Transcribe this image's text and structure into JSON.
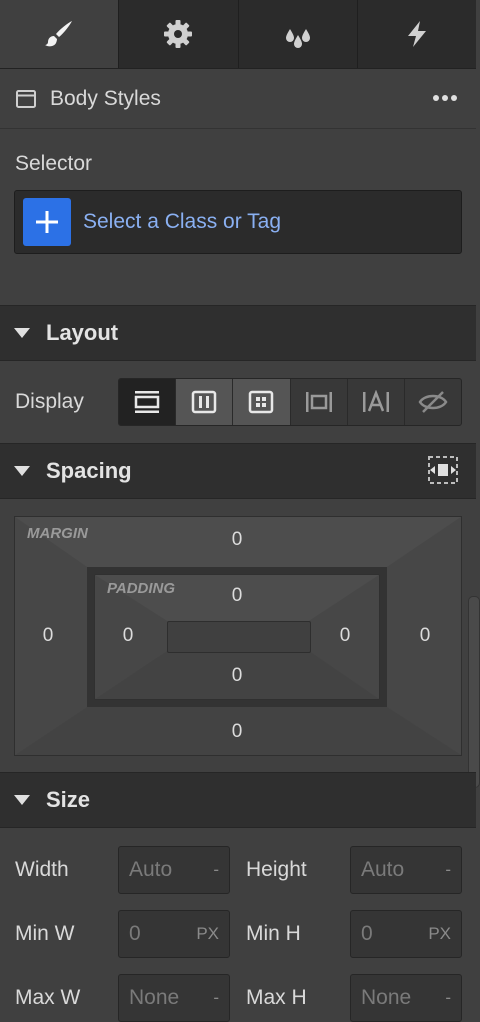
{
  "tabs": [
    {
      "icon": "paintbrush-icon",
      "active": true
    },
    {
      "icon": "gear-icon",
      "active": false
    },
    {
      "icon": "droplets-icon",
      "active": false
    },
    {
      "icon": "lightning-icon",
      "active": false
    }
  ],
  "styles_header": {
    "title": "Body Styles",
    "icon": "window-icon",
    "more_icon": "more-dots-icon"
  },
  "selector": {
    "label": "Selector",
    "placeholder": "Select a Class or Tag",
    "accent": "#2c71e6"
  },
  "layout": {
    "title": "Layout",
    "display_label": "Display",
    "display_options": [
      "block-icon",
      "flex-icon",
      "grid-icon",
      "inline-block-icon",
      "inline-icon",
      "hidden-icon"
    ],
    "selected": "block-icon"
  },
  "spacing": {
    "title": "Spacing",
    "margin_label": "MARGIN",
    "padding_label": "PADDING",
    "margin": {
      "top": "0",
      "right": "0",
      "bottom": "0",
      "left": "0"
    },
    "padding": {
      "top": "0",
      "right": "0",
      "bottom": "0",
      "left": "0"
    }
  },
  "size": {
    "title": "Size",
    "width": {
      "label": "Width",
      "value": "Auto",
      "unit": "-"
    },
    "height": {
      "label": "Height",
      "value": "Auto",
      "unit": "-"
    },
    "min_w": {
      "label": "Min W",
      "value": "0",
      "unit": "PX"
    },
    "min_h": {
      "label": "Min H",
      "value": "0",
      "unit": "PX"
    },
    "max_w": {
      "label": "Max W",
      "value": "None",
      "unit": "-"
    },
    "max_h": {
      "label": "Max H",
      "value": "None",
      "unit": "-"
    }
  }
}
